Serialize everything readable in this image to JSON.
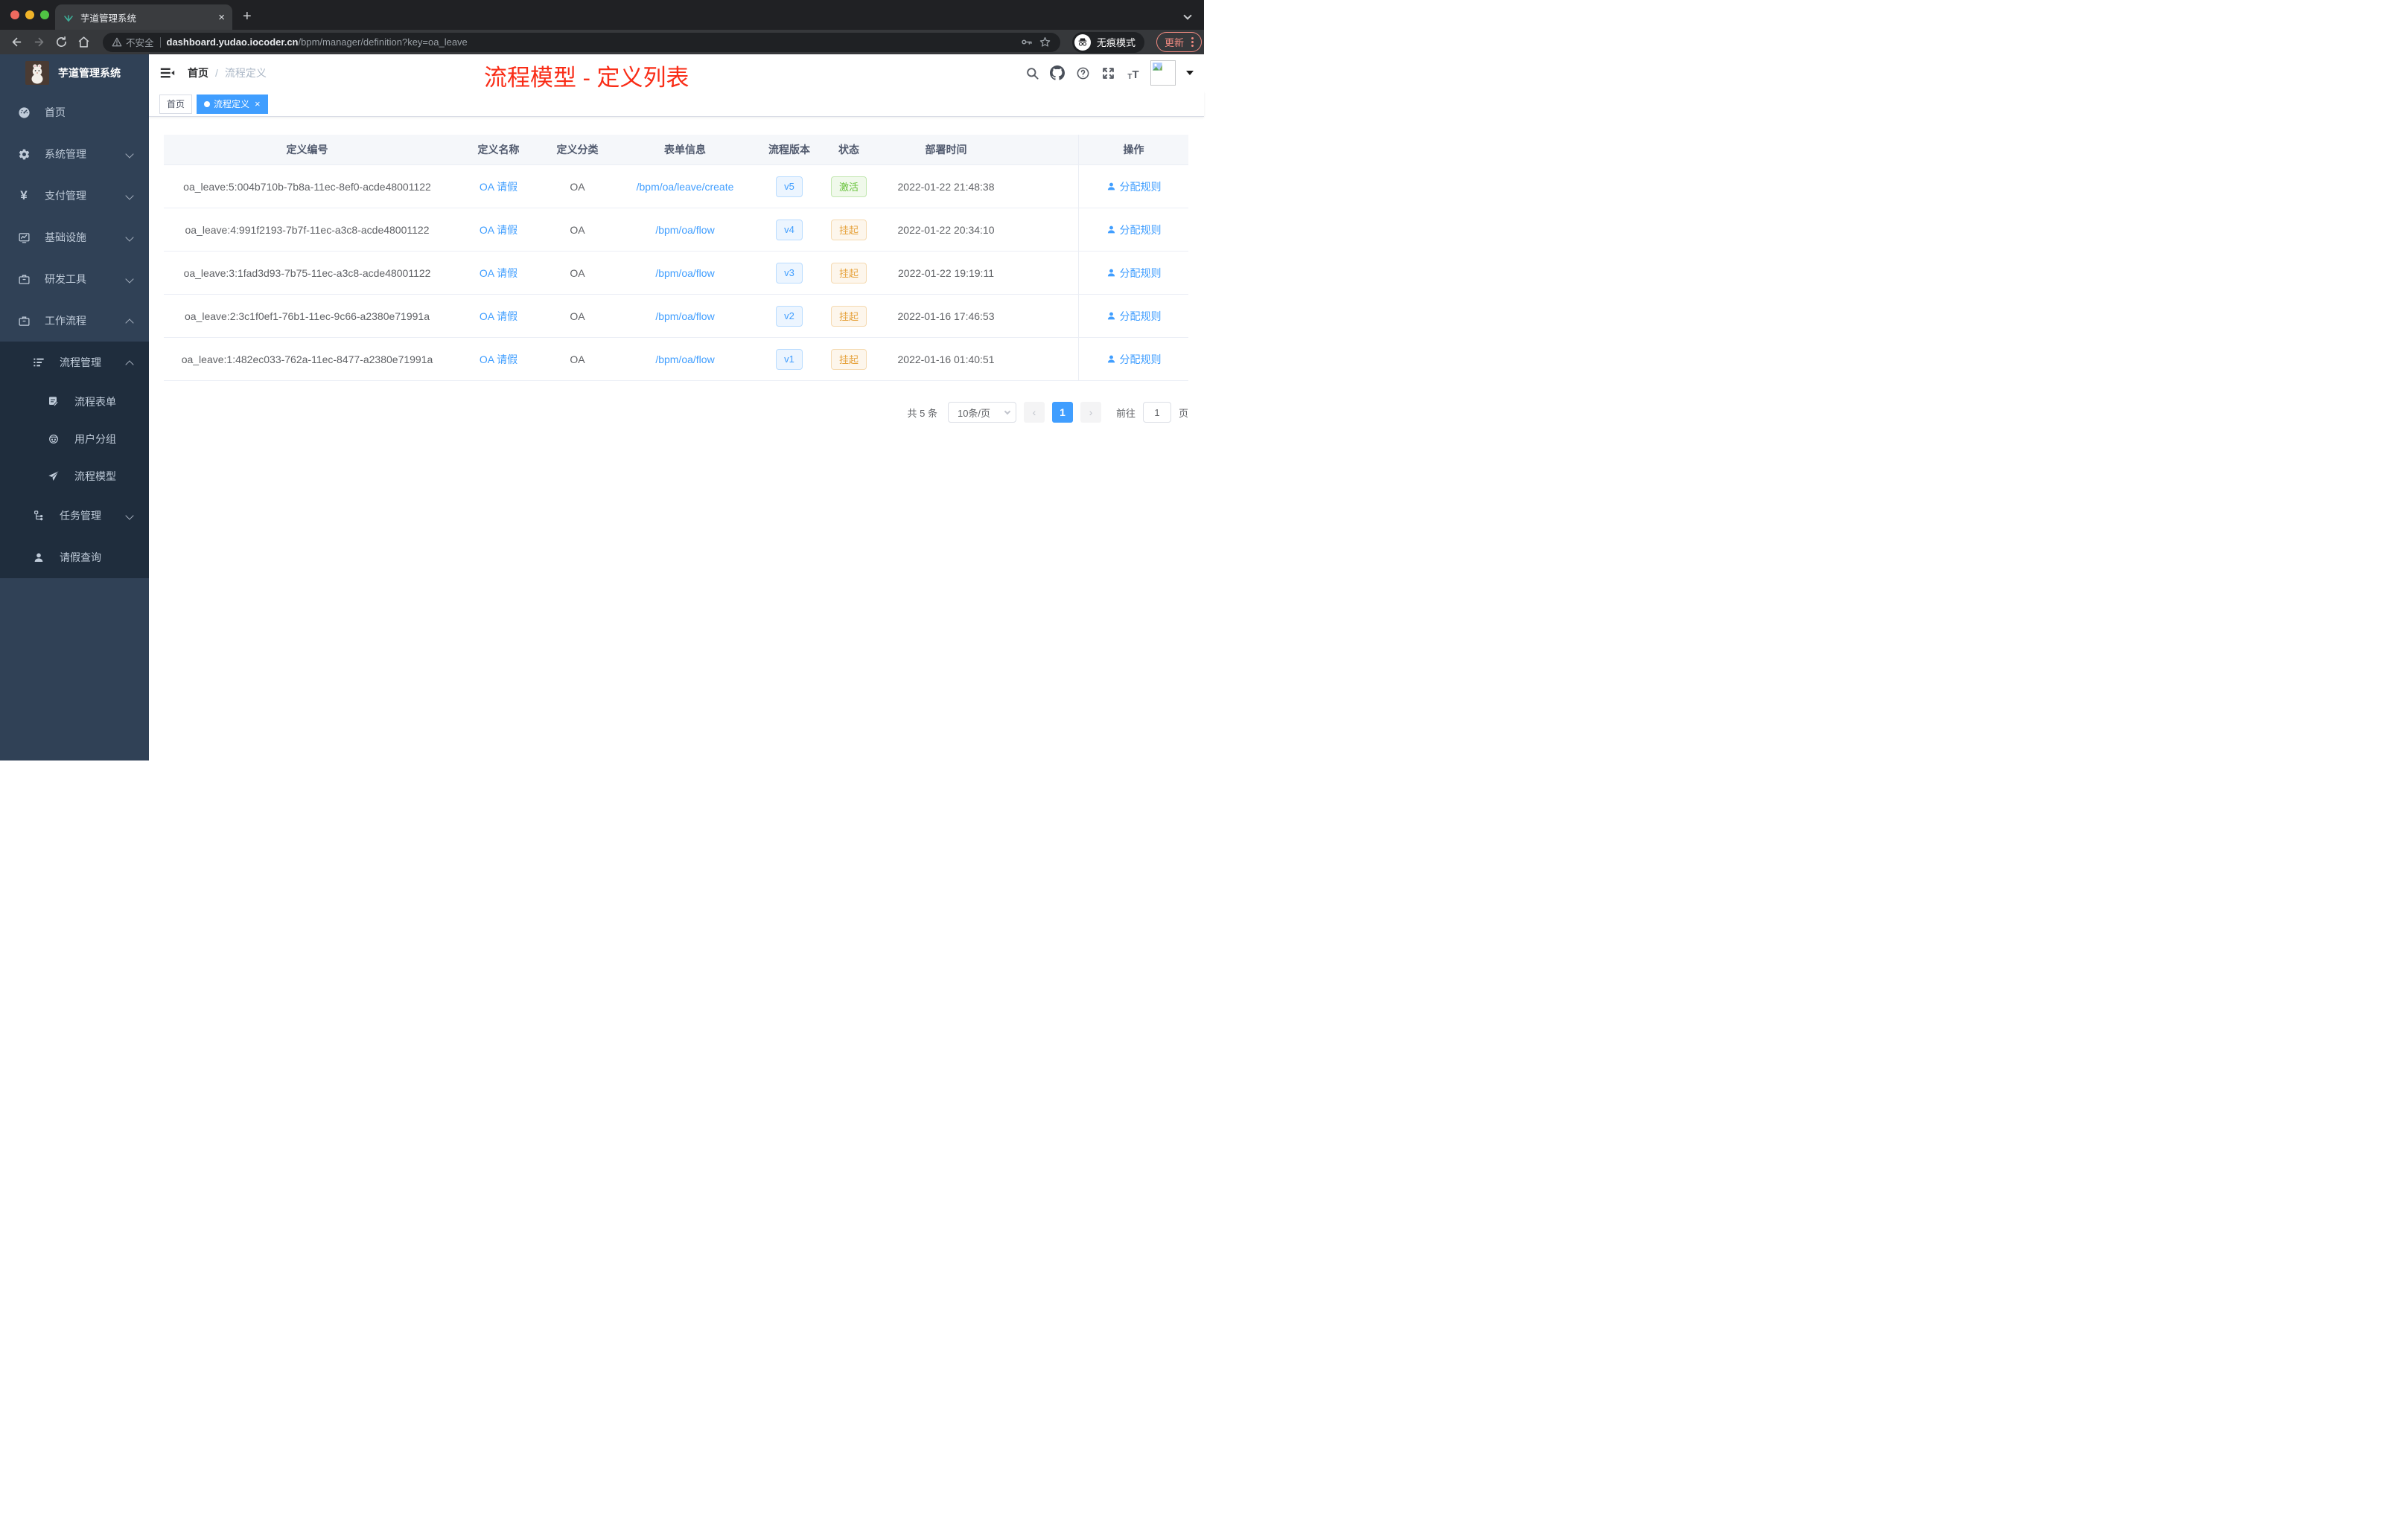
{
  "browser": {
    "tab": {
      "title": "芋道管理系统",
      "close": "×",
      "new_tab": "+"
    },
    "address": {
      "security": "不安全",
      "domain": "dashboard.yudao.iocoder.cn",
      "path": "/bpm/manager/definition?key=oa_leave"
    },
    "incognito_label": "无痕模式",
    "update_label": "更新"
  },
  "colors": {
    "accent": "#409eff",
    "annotation_red": "#f92d17",
    "sidebar_bg": "#304156",
    "submenu_bg": "#1f2d3d"
  },
  "sidebar": {
    "logo_title": "芋道管理系统",
    "menu": [
      {
        "label": "首页"
      },
      {
        "label": "系统管理"
      },
      {
        "label": "支付管理"
      },
      {
        "label": "基础设施"
      },
      {
        "label": "研发工具"
      },
      {
        "label": "工作流程"
      },
      {
        "label": "流程管理"
      },
      {
        "label": "流程表单"
      },
      {
        "label": "用户分组"
      },
      {
        "label": "流程模型"
      },
      {
        "label": "任务管理"
      },
      {
        "label": "请假查询"
      }
    ],
    "yen_symbol": "¥"
  },
  "navbar": {
    "breadcrumb_home": "首页",
    "breadcrumb_sep": "/",
    "breadcrumb_current": "流程定义",
    "annotation": "流程模型 - 定义列表"
  },
  "tags": {
    "home": "首页",
    "active": "流程定义",
    "close": "×"
  },
  "table": {
    "columns": [
      "定义编号",
      "定义名称",
      "定义分类",
      "表单信息",
      "流程版本",
      "状态",
      "部署时间",
      "操作"
    ],
    "rows": [
      {
        "id": "oa_leave:5:004b710b-7b8a-11ec-8ef0-acde48001122",
        "name": "OA 请假",
        "category": "OA",
        "form": "/bpm/oa/leave/create",
        "version": "v5",
        "status": "激活",
        "status_type": "success",
        "deploy_time": "2022-01-22 21:48:38",
        "action": "分配规则"
      },
      {
        "id": "oa_leave:4:991f2193-7b7f-11ec-a3c8-acde48001122",
        "name": "OA 请假",
        "category": "OA",
        "form": "/bpm/oa/flow",
        "version": "v4",
        "status": "挂起",
        "status_type": "warning",
        "deploy_time": "2022-01-22 20:34:10",
        "action": "分配规则"
      },
      {
        "id": "oa_leave:3:1fad3d93-7b75-11ec-a3c8-acde48001122",
        "name": "OA 请假",
        "category": "OA",
        "form": "/bpm/oa/flow",
        "version": "v3",
        "status": "挂起",
        "status_type": "warning",
        "deploy_time": "2022-01-22 19:19:11",
        "action": "分配规则"
      },
      {
        "id": "oa_leave:2:3c1f0ef1-76b1-11ec-9c66-a2380e71991a",
        "name": "OA 请假",
        "category": "OA",
        "form": "/bpm/oa/flow",
        "version": "v2",
        "status": "挂起",
        "status_type": "warning",
        "deploy_time": "2022-01-16 17:46:53",
        "action": "分配规则"
      },
      {
        "id": "oa_leave:1:482ec033-762a-11ec-8477-a2380e71991a",
        "name": "OA 请假",
        "category": "OA",
        "form": "/bpm/oa/flow",
        "version": "v1",
        "status": "挂起",
        "status_type": "warning",
        "deploy_time": "2022-01-16 01:40:51",
        "action": "分配规则"
      }
    ]
  },
  "pagination": {
    "total": "共 5 条",
    "page_size": "10条/页",
    "prev": "‹",
    "current_page": "1",
    "next": "›",
    "goto_label": "前往",
    "goto_value": "1",
    "goto_unit": "页"
  }
}
